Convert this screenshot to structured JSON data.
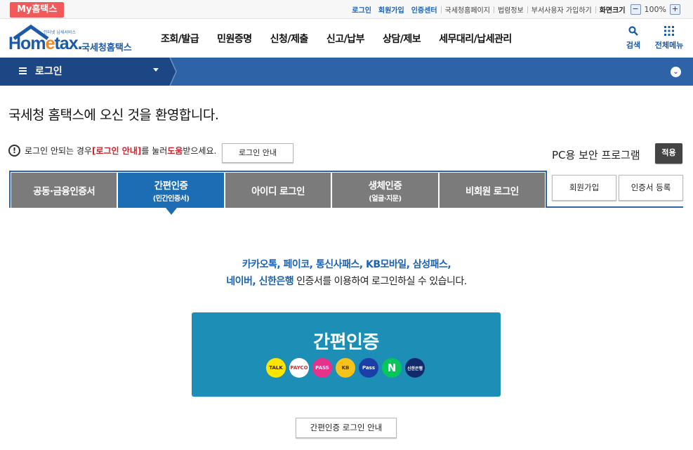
{
  "topbar": {
    "my_badge": "My홈택스",
    "links": [
      "로그인",
      "회원가입",
      "인증센터"
    ],
    "plain_links": [
      "국세청홈페이지",
      "법령정보",
      "부서사용자 가입하기"
    ],
    "zoom_label": "화면크기",
    "zoom_minus": "−",
    "zoom_value": "100%",
    "zoom_plus": "+"
  },
  "header": {
    "logo_small": "인터넷 납세서비스",
    "logo_home": "Hom",
    "logo_e": "e",
    "logo_tax": "tax.",
    "logo_kor": "국세청홈택스",
    "nav": [
      "조회/발급",
      "민원증명",
      "신청/제출",
      "신고/납부",
      "상담/제보",
      "세무대리/납세관리"
    ],
    "search_label": "검색",
    "all_menu_label": "전체메뉴"
  },
  "breadcrumb": {
    "current": "로그인"
  },
  "main": {
    "welcome": "국세청 홈택스에 오신 것을 환영합니다.",
    "notice_prefix": "로그인 안되는 경우 ",
    "notice_link": "[로그인 안내]",
    "notice_mid": "를 눌러 ",
    "notice_help": "도움",
    "notice_suffix": "받으세요.",
    "guide_button": "로그인 안내",
    "pc_security": "PC용 보안 프로그램",
    "apply_button": "적용"
  },
  "tabs": [
    {
      "label": "공동·금융인증서",
      "sub": ""
    },
    {
      "label": "간편인증",
      "sub": "(민간인증서)"
    },
    {
      "label": "아이디 로그인",
      "sub": ""
    },
    {
      "label": "생체인증",
      "sub": "(얼굴·지문)"
    },
    {
      "label": "비회원 로그인",
      "sub": ""
    }
  ],
  "side_buttons": {
    "signup": "회원가입",
    "cert_register": "인증서 등록"
  },
  "content": {
    "line1_blue": "카카오톡, 페이코, 통신사패스, KB모바일, 삼성패스,",
    "line2_blue": "네이버, 신한은행",
    "line2_rest": " 인증서를 이용하여 로그인하실 수 있습니다.",
    "box_title": "간편인증",
    "providers": [
      {
        "name": "kakao",
        "text": "TALK",
        "bg": "#fee500",
        "fg": "#3c1e1e"
      },
      {
        "name": "payco",
        "text": "PAYCO",
        "bg": "#ffffff",
        "fg": "#e0282d"
      },
      {
        "name": "pass",
        "text": "PASS",
        "bg": "#e8318a",
        "fg": "#ffffff"
      },
      {
        "name": "kb",
        "text": "KB",
        "bg": "#f7c21a",
        "fg": "#3b3024"
      },
      {
        "name": "samsung-pass",
        "text": "Pass",
        "bg": "#1b3fa6",
        "fg": "#ffffff"
      },
      {
        "name": "naver",
        "text": "N",
        "bg": "#03c75a",
        "fg": "#ffffff"
      },
      {
        "name": "shinhan",
        "text": "신한은행",
        "bg": "#12296b",
        "fg": "#ffffff"
      }
    ],
    "bottom_button": "간편인증 로그인 안내"
  }
}
